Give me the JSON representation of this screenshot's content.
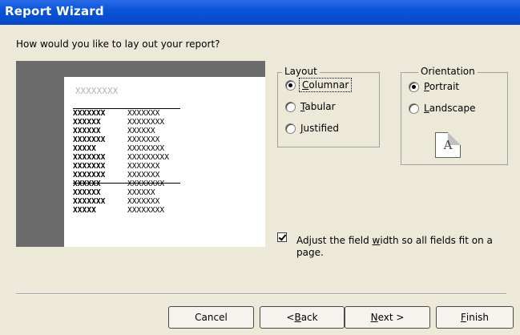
{
  "window": {
    "title": "Report Wizard"
  },
  "prompt": "How would you like to lay out your report?",
  "preview": {
    "title_placeholder": "XXXXXXXX",
    "col1": [
      "XXXXXXX",
      "XXXXXX",
      "XXXXXX",
      "XXXXXXX",
      "XXXXX",
      "XXXXXXX",
      "XXXXXXX",
      "XXXXXXX",
      "XXXXXX",
      "XXXXXX",
      "XXXXXXX",
      "XXXXX"
    ],
    "col2": [
      "XXXXXXX",
      "XXXXXXXX",
      "XXXXXX",
      "XXXXXXX",
      "XXXXXXXX",
      "XXXXXXXXX",
      "XXXXXXX",
      "XXXXXXX",
      "XXXXXXXX",
      "XXXXXX",
      "XXXXXXX",
      "XXXXXXXX"
    ]
  },
  "layout": {
    "legend": "Layout",
    "options": [
      {
        "label": "Columnar",
        "mnemonic": "C",
        "rest": "olumnar",
        "checked": true
      },
      {
        "label": "Tabular",
        "mnemonic": "T",
        "rest": "abular",
        "checked": false
      },
      {
        "label": "Justified",
        "mnemonic": "J",
        "rest": "ustified",
        "checked": false
      }
    ]
  },
  "orientation": {
    "legend": "Orientation",
    "options": [
      {
        "label": "Portrait",
        "mnemonic": "P",
        "rest": "ortrait",
        "checked": true
      },
      {
        "label": "Landscape",
        "mnemonic": "L",
        "rest": "andscape",
        "checked": false
      }
    ],
    "icon_letter": "A"
  },
  "adjust_width": {
    "checked": true,
    "label_pre": "Adjust the field ",
    "label_mnemonic": "w",
    "label_post": "idth so all fields fit on a page."
  },
  "buttons": {
    "cancel": "Cancel",
    "back_pre": "< ",
    "back_mn": "B",
    "back_post": "ack",
    "next_mn": "N",
    "next_post": "ext >",
    "finish_mn": "F",
    "finish_post": "inish"
  }
}
